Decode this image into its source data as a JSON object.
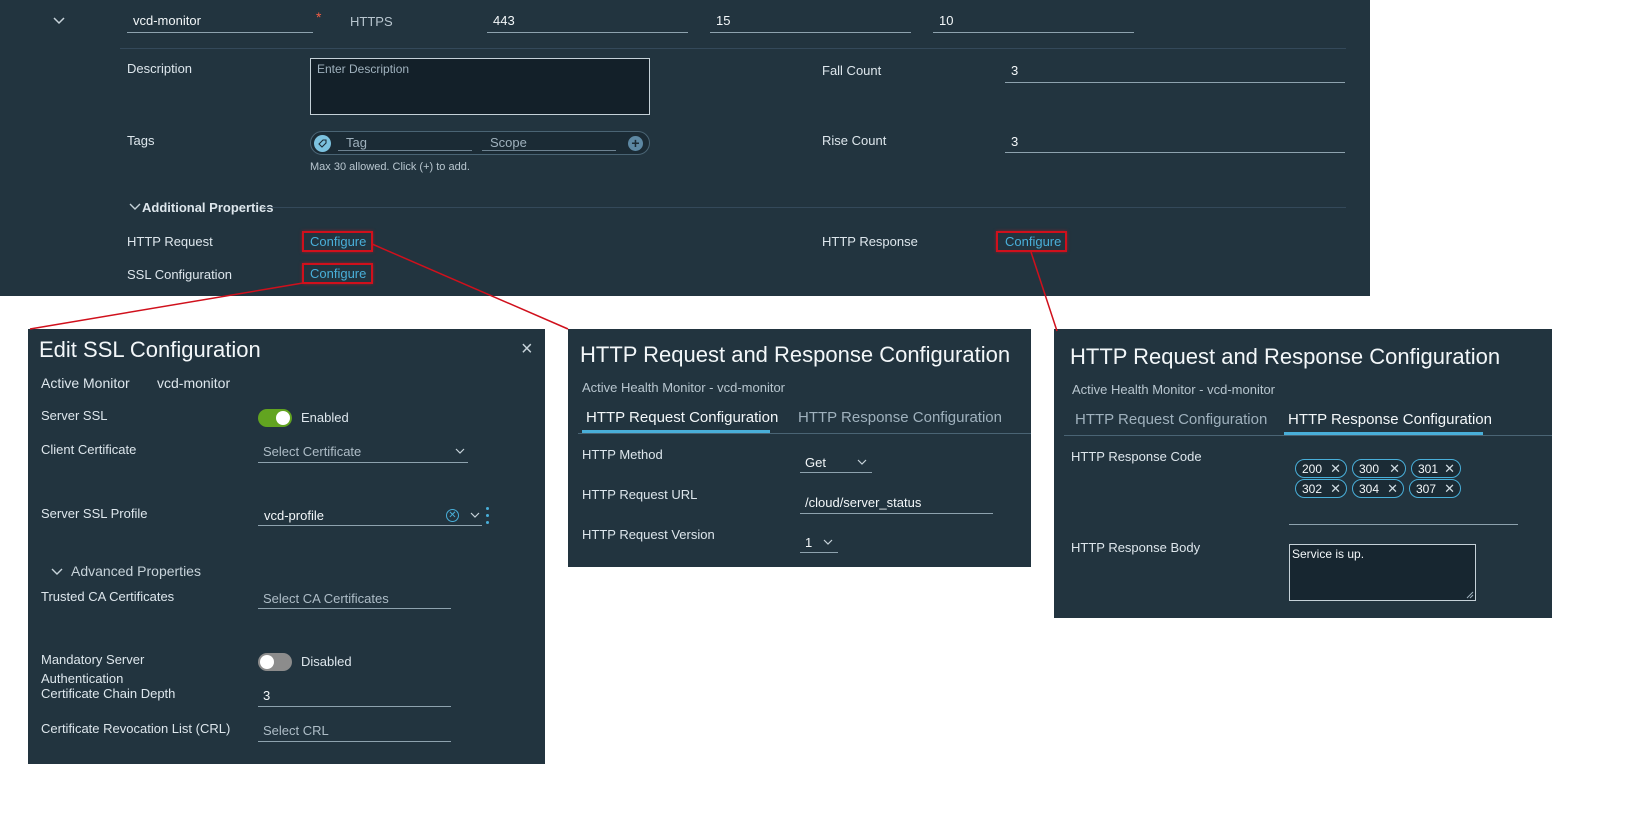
{
  "top_panel": {
    "row": {
      "name": "vcd-monitor",
      "required_mark": "*",
      "type": "HTTPS",
      "port": "443",
      "interval": "15",
      "timeout": "10"
    },
    "description": {
      "label": "Description",
      "placeholder": "Enter Description"
    },
    "tags": {
      "label": "Tags",
      "tag_placeholder": "Tag",
      "scope_placeholder": "Scope",
      "hint": "Max 30 allowed. Click (+) to add."
    },
    "fall_count": {
      "label": "Fall Count",
      "value": "3"
    },
    "rise_count": {
      "label": "Rise Count",
      "value": "3"
    },
    "additional_properties": "Additional Properties",
    "http_request": {
      "label": "HTTP Request",
      "link": "Configure"
    },
    "ssl_configuration": {
      "label": "SSL Configuration",
      "link": "Configure"
    },
    "http_response": {
      "label": "HTTP Response",
      "link": "Configure"
    }
  },
  "ssl_panel": {
    "title": "Edit SSL Configuration",
    "close": "×",
    "monitor_label": "Active Monitor",
    "monitor_value": "vcd-monitor",
    "server_ssl": {
      "label": "Server SSL",
      "state": "Enabled",
      "on": true
    },
    "client_certificate": {
      "label": "Client Certificate",
      "placeholder": "Select Certificate"
    },
    "server_ssl_profile": {
      "label": "Server SSL Profile",
      "value": "vcd-profile"
    },
    "advanced_properties": "Advanced Properties",
    "trusted_ca": {
      "label": "Trusted CA Certificates",
      "placeholder": "Select CA Certificates"
    },
    "mandatory_auth": {
      "label_line1": "Mandatory Server",
      "label_line2": "Authentication",
      "state": "Disabled",
      "on": false
    },
    "chain_depth": {
      "label": "Certificate Chain Depth",
      "value": "3"
    },
    "crl": {
      "label": "Certificate Revocation List (CRL)",
      "placeholder": "Select CRL"
    }
  },
  "request_panel": {
    "title": "HTTP Request and Response Configuration",
    "subtitle": "Active Health Monitor - vcd-monitor",
    "tabs": [
      "HTTP Request Configuration",
      "HTTP Response Configuration"
    ],
    "active_tab": 0,
    "method": {
      "label": "HTTP Method",
      "value": "Get"
    },
    "url": {
      "label": "HTTP Request URL",
      "value": "/cloud/server_status"
    },
    "version": {
      "label": "HTTP Request Version",
      "value": "1"
    }
  },
  "response_panel": {
    "title": "HTTP Request and Response Configuration",
    "subtitle": "Active Health Monitor - vcd-monitor",
    "tabs": [
      "HTTP Request Configuration",
      "HTTP Response Configuration"
    ],
    "active_tab": 1,
    "code": {
      "label": "HTTP Response Code",
      "chips": [
        "200",
        "300",
        "301",
        "302",
        "304",
        "307"
      ]
    },
    "body": {
      "label": "HTTP Response Body",
      "value": "Service is up."
    }
  },
  "colors": {
    "panel_bg": "#22343f",
    "accent": "#49afd9",
    "highlight": "#d0101c",
    "toggle_on": "#62a420",
    "toggle_off": "#8c8c8c"
  }
}
